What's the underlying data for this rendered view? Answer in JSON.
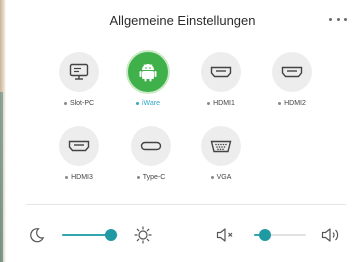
{
  "header": {
    "title": "Allgemeine Einstellungen"
  },
  "sources": [
    {
      "label": "Slot-PC",
      "icon": "monitor-icon",
      "active": false
    },
    {
      "label": "iWare",
      "icon": "android-icon",
      "active": true
    },
    {
      "label": "HDMI1",
      "icon": "hdmi-icon",
      "active": false
    },
    {
      "label": "HDMI2",
      "icon": "hdmi-icon",
      "active": false
    },
    {
      "label": "HDMI3",
      "icon": "hdmi-icon",
      "active": false
    },
    {
      "label": "Type-C",
      "icon": "usb-c-icon",
      "active": false
    },
    {
      "label": "VGA",
      "icon": "vga-icon",
      "active": false
    }
  ],
  "brightness": {
    "level": 0.88
  },
  "volume": {
    "level": 0.22
  },
  "colors": {
    "accent": "#31a6ad",
    "active_source": "#3fb04a",
    "active_label": "#33a8c9"
  }
}
